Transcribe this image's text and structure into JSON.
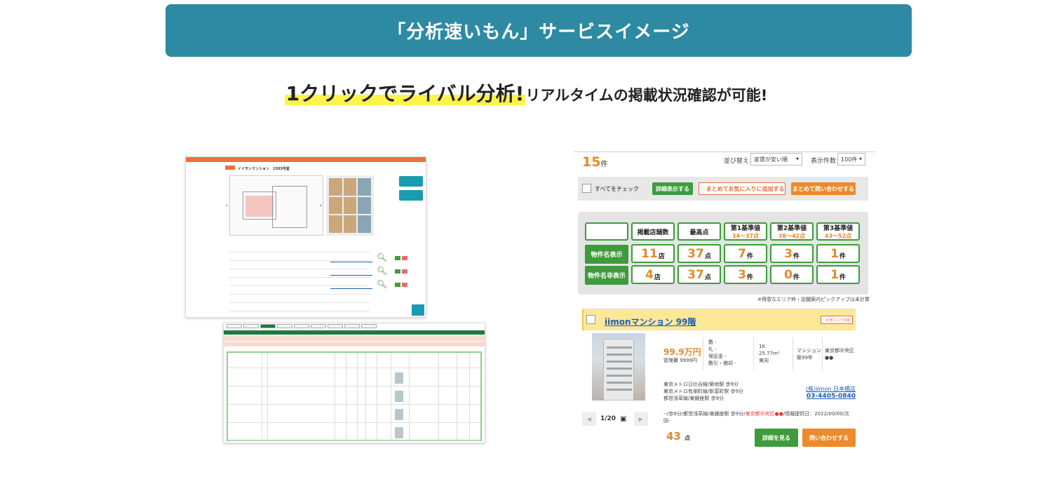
{
  "banner": {
    "title": "「分析速いもん」サービスイメージ"
  },
  "subheading": {
    "highlight": "1クリックでライバル分析!",
    "rest": "リアルタイムの掲載状況確認が可能!"
  },
  "left_preview": {
    "property_title": "イイモンマンション　1503号室"
  },
  "results": {
    "count": "15",
    "count_unit": "件",
    "sort_label": "並び替え：",
    "sort_value": "家賃が安い順",
    "per_page_label": "表示件数：",
    "per_page_value": "100件",
    "check_all": "すべてをチェック",
    "detail_button": "詳細表示する",
    "favorite_button": "まとめてお気に入りに追加する",
    "inquire_button": "まとめて問い合わせする"
  },
  "stats": {
    "headers": [
      {
        "label": "掲載店舗数",
        "range": ""
      },
      {
        "label": "最高点",
        "range": ""
      },
      {
        "label": "第1基準値",
        "range": "34〜37点"
      },
      {
        "label": "第2基準値",
        "range": "38〜42点"
      },
      {
        "label": "第3基準値",
        "range": "43〜52点"
      }
    ],
    "rows": [
      {
        "label": "物件名表示",
        "values": [
          {
            "num": "11",
            "unit": "店"
          },
          {
            "num": "37",
            "unit": "点"
          },
          {
            "num": "7",
            "unit": "件"
          },
          {
            "num": "3",
            "unit": "件"
          },
          {
            "num": "1",
            "unit": "件"
          }
        ]
      },
      {
        "label": "物件名非表示",
        "values": [
          {
            "num": "4",
            "unit": "店"
          },
          {
            "num": "37",
            "unit": "点"
          },
          {
            "num": "3",
            "unit": "件"
          },
          {
            "num": "0",
            "unit": "件"
          },
          {
            "num": "1",
            "unit": "件"
          }
        ]
      }
    ],
    "note": "※得意なエリア枠・店舗案内ピックアップは未計算"
  },
  "listing": {
    "name": "iimonマンション 99階",
    "favorite": "お気に入り追加",
    "price": "99.9万円",
    "management_fee": "管理費 9999円",
    "deposit_lines": [
      "敷 -",
      "礼 -",
      "保証金 -",
      "敷引・償却 -"
    ],
    "layout": "1K",
    "area": "25.77m²",
    "direction": "東向",
    "type": "マンション",
    "age": "築99年",
    "address": "東京都中央区●●",
    "access_lines": [
      "東京メトロ日比谷線/築地駅 歩9分",
      "東京メトロ有楽町線/新富町駅 歩9分",
      "都営浅草線/東銀座駅 歩9分"
    ],
    "agent_name": "(株)iimon 日本橋店",
    "agent_phone": "03-4405-0840",
    "footer_pre": "--/歩9分/都営浅草線/東銀座駅 歩9分/",
    "footer_red": "東京都中央区●●",
    "footer_post": "/情報提供日：2022/00/00/次回-",
    "page": "1/20",
    "score": "43",
    "score_unit": "点",
    "detail_button": "詳細を見る",
    "inquire_button": "問い合わせする"
  }
}
